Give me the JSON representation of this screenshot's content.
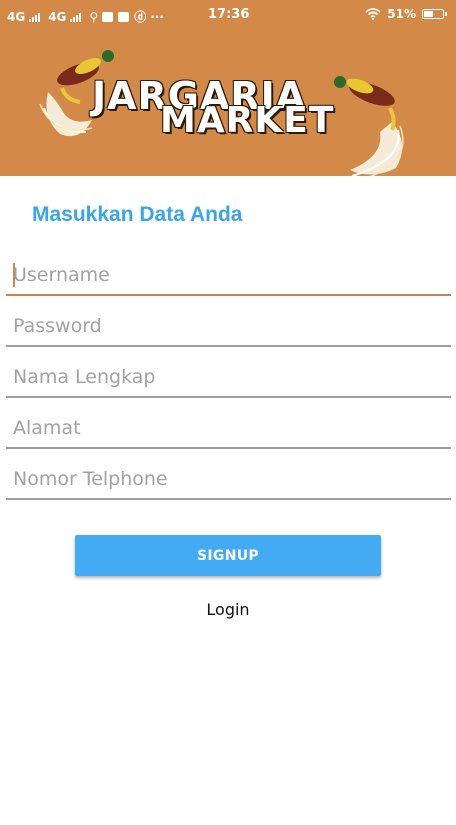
{
  "status_bar": {
    "network1": "4G",
    "network2": "4G",
    "time": "17:36",
    "battery_percent": "51%",
    "battery_level": 0.51,
    "more": "···"
  },
  "header": {
    "logo_line1": "JARGARIA",
    "logo_line2": "MARKET",
    "background_color": "#d38a48"
  },
  "form": {
    "title": "Masukkan Data Anda",
    "title_color": "#3aa4ec",
    "fields": [
      {
        "placeholder": "Username",
        "value": ""
      },
      {
        "placeholder": "Password",
        "value": ""
      },
      {
        "placeholder": "Nama Lengkap",
        "value": ""
      },
      {
        "placeholder": "Alamat",
        "value": ""
      },
      {
        "placeholder": "Nomor Telphone",
        "value": ""
      }
    ],
    "signup_label": "SIGNUP",
    "signup_color": "#43abf3",
    "login_label": "Login"
  }
}
